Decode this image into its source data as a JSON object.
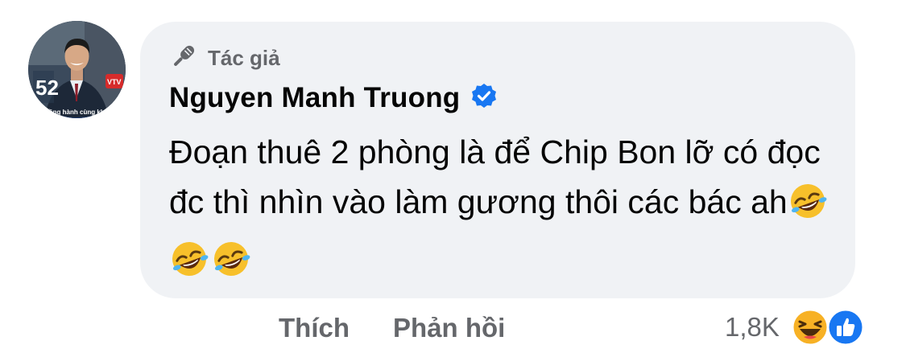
{
  "author": {
    "badge_label": "Tác giả",
    "name": "Nguyen Manh Truong",
    "verified": true
  },
  "comment": {
    "text": "Đoạn thuê 2 phòng là để Chip Bon lỡ có đọc đc thì nhìn vào làm gương thôi các bác ah",
    "emojis": [
      "rolling-on-floor-laughing",
      "rolling-on-floor-laughing",
      "rolling-on-floor-laughing"
    ]
  },
  "actions": {
    "like_label": "Thích",
    "reply_label": "Phản hồi"
  },
  "reactions": {
    "count": "1,8K",
    "types": [
      "haha",
      "like"
    ]
  },
  "avatar": {
    "caption": "Đồng hành cùng khán giả",
    "number": "52",
    "logo": "VTV"
  },
  "colors": {
    "bubble": "#f0f2f5",
    "secondary_text": "#65676b",
    "primary_text": "#050505",
    "verified_blue": "#1877f2",
    "like_blue": "#1877f2",
    "haha_yellow": "#f7b125"
  }
}
